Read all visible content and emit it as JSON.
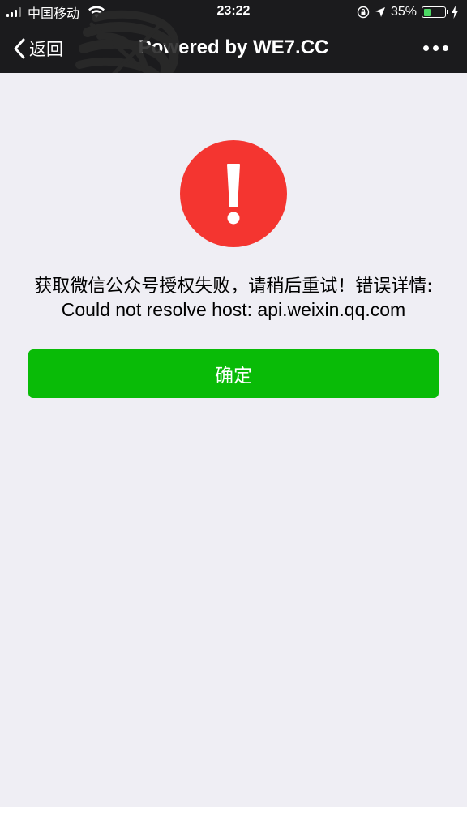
{
  "status_bar": {
    "carrier": "中国移动",
    "time": "23:22",
    "battery_percent_text": "35%",
    "battery_level": 0.35,
    "signal_bars_active": 3,
    "signal_bars_total": 4,
    "battery_color": "#4cd964"
  },
  "nav": {
    "back_label": "返回",
    "title": "Powered by WE7.CC",
    "back_icon": "chevron-left-icon",
    "more_icon": "more-dots-icon"
  },
  "error": {
    "icon": "exclamation-icon",
    "icon_color": "#f43530",
    "message_cn": "获取微信公众号授权失败，请稍后重试！错误详情:",
    "message_en": "Could not resolve host: api.weixin.qq.com"
  },
  "actions": {
    "confirm_label": "确定",
    "confirm_color": "#09bb07"
  }
}
